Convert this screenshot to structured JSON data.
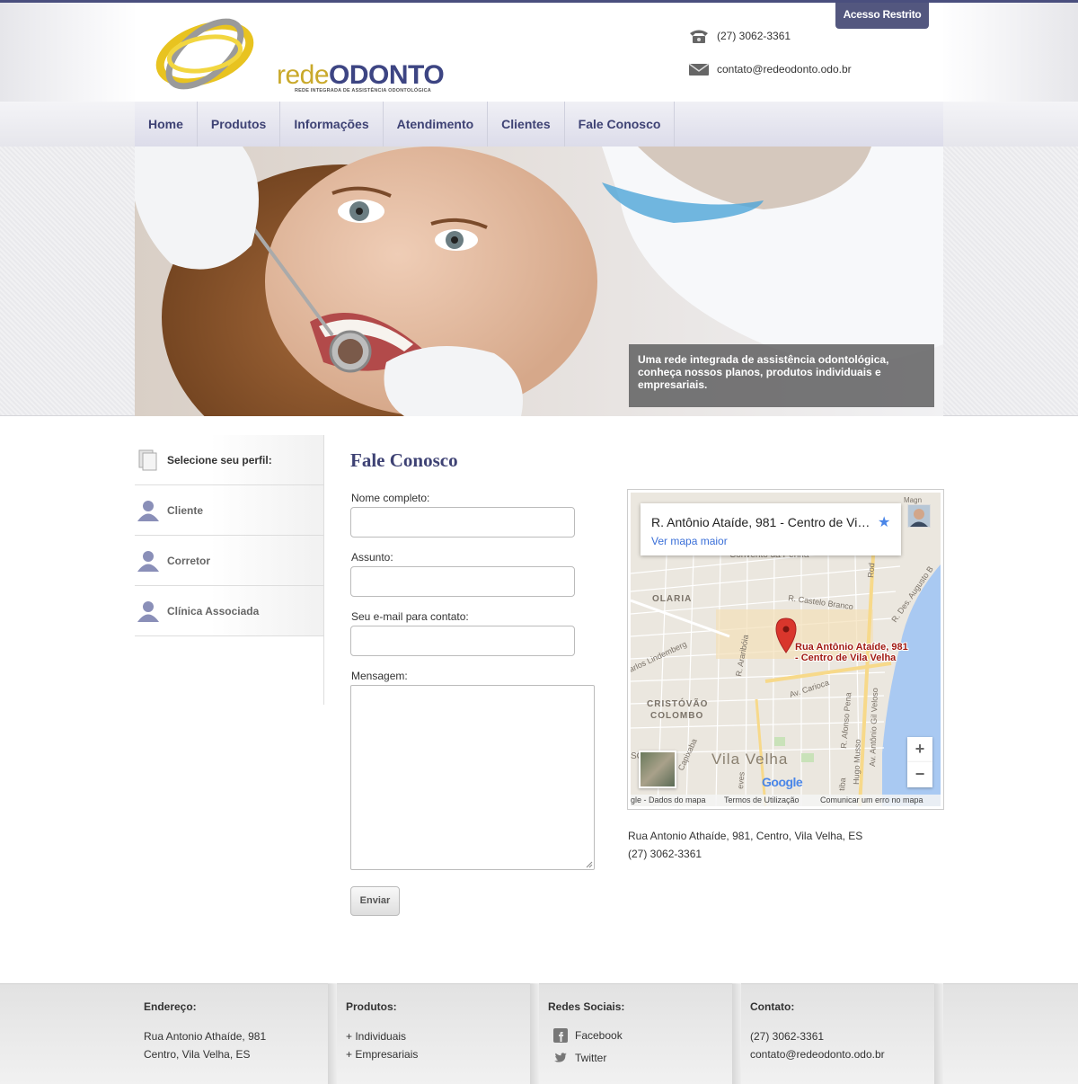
{
  "header": {
    "logo_rede": "rede",
    "logo_odonto": "ODONTO",
    "logo_tagline": "REDE INTEGRADA DE ASSISTÊNCIA ODONTOLÓGICA",
    "restricted_label": "Acesso Restrito",
    "phone": "(27) 3062-3361",
    "email": "contato@redeodonto.odo.br"
  },
  "nav": {
    "items": [
      {
        "label": "Home"
      },
      {
        "label": "Produtos"
      },
      {
        "label": "Informações"
      },
      {
        "label": "Atendimento"
      },
      {
        "label": "Clientes"
      },
      {
        "label": "Fale Conosco"
      }
    ]
  },
  "hero": {
    "caption": "Uma rede integrada de assistência odontológica, conheça nossos planos, produtos individuais e empresariais."
  },
  "sidebar": {
    "heading": "Selecione seu perfil:",
    "items": [
      {
        "label": "Cliente"
      },
      {
        "label": "Corretor"
      },
      {
        "label": "Clínica Associada"
      }
    ]
  },
  "form": {
    "title": "Fale Conosco",
    "name_label": "Nome completo:",
    "subject_label": "Assunto:",
    "email_label": "Seu e-mail para contato:",
    "message_label": "Mensagem:",
    "submit_label": "Enviar"
  },
  "map": {
    "card_title": "R. Antônio Ataíde, 981 - Centro de Vi…",
    "card_link": "Ver mapa maior",
    "pin_label_1": "Rua Antônio Ataíde, 981",
    "pin_label_2": "- Centro de Vila Velha",
    "place_olaria": "OLARIA",
    "place_cristovao": "CRISTÓVÃO",
    "place_colombo": "COLOMBO",
    "place_vila_velha": "Vila Velha",
    "place_convento": "Convento da Penha",
    "street_castelo": "R. Castelo Branco",
    "street_carioca": "Av. Carioca",
    "street_lindemberg": "arlos Lindemberg",
    "street_araribola": "R. Araribóia",
    "street_rod": "Rod",
    "street_augusto": "R. Des. Augusto B",
    "street_afonso": "R. Afonso Pena",
    "street_gil": "Av. Antônio Gil Veloso",
    "street_hugo": "Hugo Musso",
    "street_capixaba": "Capixaba",
    "street_magn": "Magn",
    "street_eves": "eves",
    "street_tiba": "tiba",
    "street_sc": "SC",
    "zoom_in": "+",
    "zoom_out": "−",
    "google": "Google",
    "bottom_data": "gle - Dados do mapa",
    "bottom_terms": "Termos de Utilização",
    "bottom_report": "Comunicar um erro no mapa"
  },
  "address": {
    "line1": "Rua Antonio Athaíde, 981, Centro, Vila Velha, ES",
    "line2": "(27) 3062-3361"
  },
  "footer": {
    "address_title": "Endereço:",
    "address_l1": "Rua Antonio Athaíde, 981",
    "address_l2": "Centro, Vila Velha, ES",
    "products_title": "Produtos:",
    "product_1": "+ Individuais",
    "product_2": "+ Empresariais",
    "social_title": "Redes Sociais:",
    "social_facebook": "Facebook",
    "social_twitter": "Twitter",
    "contact_title": "Contato:",
    "contact_phone": "(27) 3062-3361",
    "contact_email": "contato@redeodonto.odo.br"
  },
  "colors": {
    "brand_navy": "#3e4274",
    "brand_gold": "#c9a92b",
    "restricted_bg": "#53577f",
    "map_pin": "#d9362c"
  }
}
